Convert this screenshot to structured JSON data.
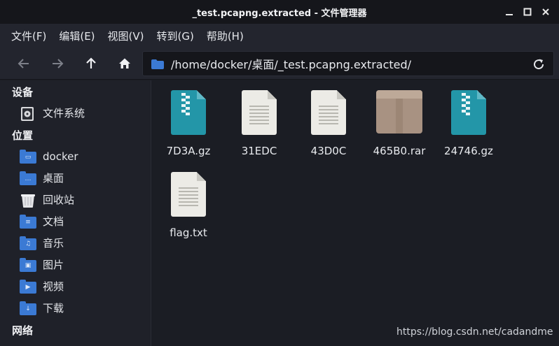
{
  "window": {
    "title": "_test.pcapng.extracted - 文件管理器"
  },
  "menu": [
    "文件(F)",
    "编辑(E)",
    "视图(V)",
    "转到(G)",
    "帮助(H)"
  ],
  "toolbar": {
    "path": "/home/docker/桌面/_test.pcapng.extracted/"
  },
  "sidebar": {
    "devices_heading": "设备",
    "devices": [
      {
        "label": "文件系统",
        "icon": "drive-icon"
      }
    ],
    "places_heading": "位置",
    "places": [
      {
        "label": "docker",
        "icon": "home-folder-icon"
      },
      {
        "label": "桌面",
        "icon": "desktop-folder-icon"
      },
      {
        "label": "回收站",
        "icon": "trash-icon"
      },
      {
        "label": "文档",
        "icon": "documents-folder-icon"
      },
      {
        "label": "音乐",
        "icon": "music-folder-icon"
      },
      {
        "label": "图片",
        "icon": "pictures-folder-icon"
      },
      {
        "label": "视频",
        "icon": "videos-folder-icon"
      },
      {
        "label": "下载",
        "icon": "downloads-folder-icon"
      }
    ],
    "network_heading": "网络"
  },
  "files": [
    {
      "name": "7D3A.gz",
      "kind": "archive"
    },
    {
      "name": "31EDC",
      "kind": "document"
    },
    {
      "name": "43D0C",
      "kind": "document"
    },
    {
      "name": "465B0.rar",
      "kind": "rar"
    },
    {
      "name": "24746.gz",
      "kind": "archive"
    },
    {
      "name": "flag.txt",
      "kind": "document"
    }
  ],
  "watermark": "https://blog.csdn.net/cadandme",
  "colors": {
    "accent": "#3b7ad4",
    "archive": "#2396a8",
    "background": "#1b1d24"
  }
}
